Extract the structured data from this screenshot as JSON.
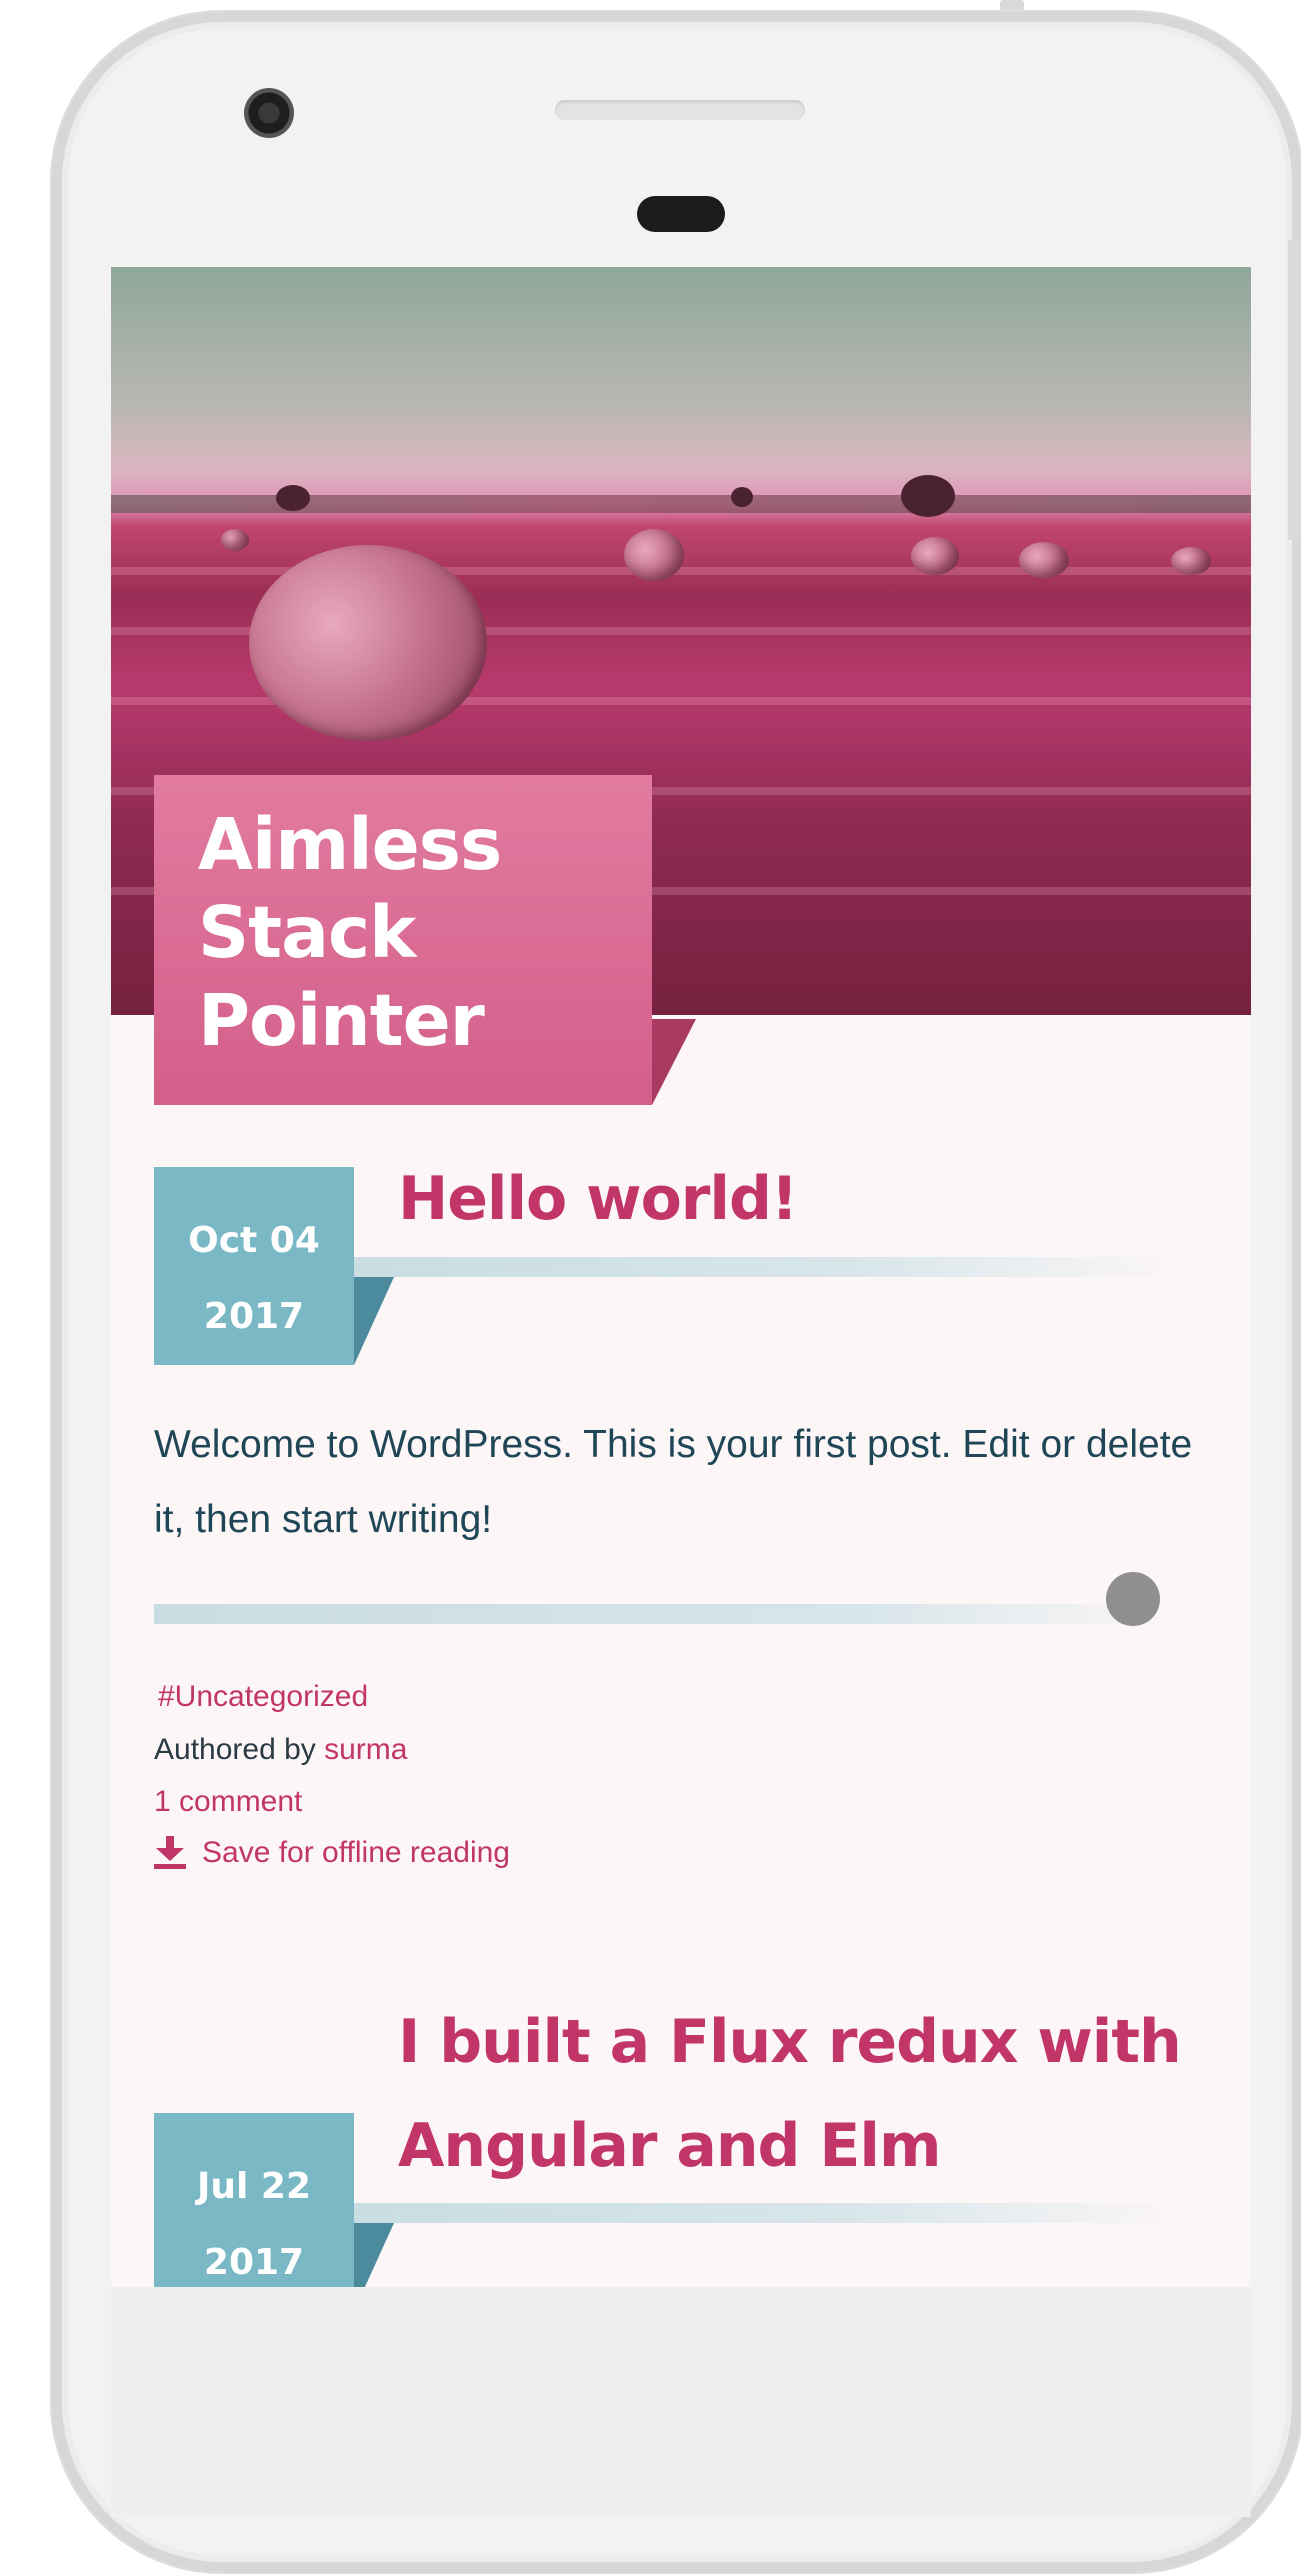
{
  "blog": {
    "title_lines": [
      "Aimless",
      "Stack",
      "Pointer"
    ]
  },
  "posts": [
    {
      "date_month_day": "Oct 04",
      "date_year": "2017",
      "title_lines": [
        "Hello world!"
      ],
      "body": "Welcome to WordPress. This is your first post. Edit or delete it, then start writing!",
      "category": "#Uncategorized",
      "authored_prefix": "Authored by",
      "author": "surma",
      "comments": "1 comment",
      "save_label": "Save for offline reading",
      "read_progress": 0.96
    },
    {
      "date_month_day": "Jul 22",
      "date_year": "2017",
      "title_lines": [
        "I built a Flux redux with",
        "Angular and Elm"
      ]
    }
  ],
  "icons": {
    "save": "download-icon"
  },
  "colors": {
    "accent": "#c23568",
    "title_box": "#d35f8a",
    "date_box": "#7ab8c6",
    "body_text": "#1f4656",
    "background": "#fcf6f7"
  }
}
